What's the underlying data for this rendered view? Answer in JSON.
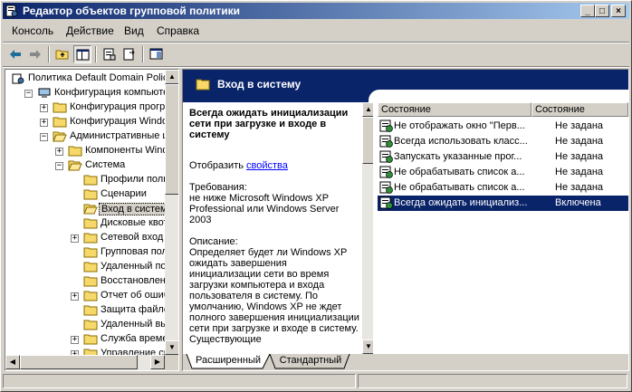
{
  "window": {
    "title": "Редактор объектов групповой политики"
  },
  "menu": [
    "Консоль",
    "Действие",
    "Вид",
    "Справка"
  ],
  "tree": {
    "items": [
      {
        "label": "Политика Default Domain Polic",
        "depth": 0
      },
      {
        "label": "Конфигурация компьютер",
        "depth": 1
      },
      {
        "label": "Конфигурация програ",
        "depth": 2
      },
      {
        "label": "Конфигурация Window",
        "depth": 2
      },
      {
        "label": "Административные ша",
        "depth": 2
      },
      {
        "label": "Компоненты Windo",
        "depth": 3
      },
      {
        "label": "Система",
        "depth": 3
      },
      {
        "label": "Профили польз",
        "depth": 4
      },
      {
        "label": "Сценарии",
        "depth": 4
      },
      {
        "label": "Вход в систему",
        "depth": 4
      },
      {
        "label": "Дисковые квот",
        "depth": 4
      },
      {
        "label": "Сетевой вход",
        "depth": 4
      },
      {
        "label": "Групповая поли",
        "depth": 4
      },
      {
        "label": "Удаленный пом",
        "depth": 4
      },
      {
        "label": "Восстановлени",
        "depth": 4
      },
      {
        "label": "Отчет об ошиб",
        "depth": 4
      },
      {
        "label": "Защита файло",
        "depth": 4
      },
      {
        "label": "Удаленный вы",
        "depth": 4
      },
      {
        "label": "Служба времен",
        "depth": 4
      },
      {
        "label": "Управление св",
        "depth": 4
      }
    ]
  },
  "header": {
    "title": "Вход в систему"
  },
  "description": {
    "title": "Всегда ожидать инициализации сети при загрузке и входе в систему",
    "show_prefix": "Отобразить ",
    "show_link": "свойства",
    "requirements_label": "Требования:",
    "requirements_text": "не ниже Microsoft Windows XP Professional или Windows Server 2003",
    "description_label": "Описание:",
    "description_text": "Определяет будет ли Windows XP ожидать завершения инициализации сети во время загрузки компьютера и входа пользователя в систему. По умолчанию, Windows XP не ждет полного завершения инициализации сети при загрузке и входе в систему. Существующие"
  },
  "list": {
    "columns": [
      "Состояние",
      "Состояние"
    ],
    "rows": [
      {
        "name": "Не отображать окно \"Перв...",
        "state": "Не задана"
      },
      {
        "name": "Всегда использовать класс...",
        "state": "Не задана"
      },
      {
        "name": "Запускать указанные прог...",
        "state": "Не задана"
      },
      {
        "name": "Не обрабатывать список а...",
        "state": "Не задана"
      },
      {
        "name": "Не обрабатывать список а...",
        "state": "Не задана"
      },
      {
        "name": "Всегда ожидать инициализ...",
        "state": "Включена"
      }
    ]
  },
  "tabs": [
    "Расширенный",
    "Стандартный"
  ]
}
